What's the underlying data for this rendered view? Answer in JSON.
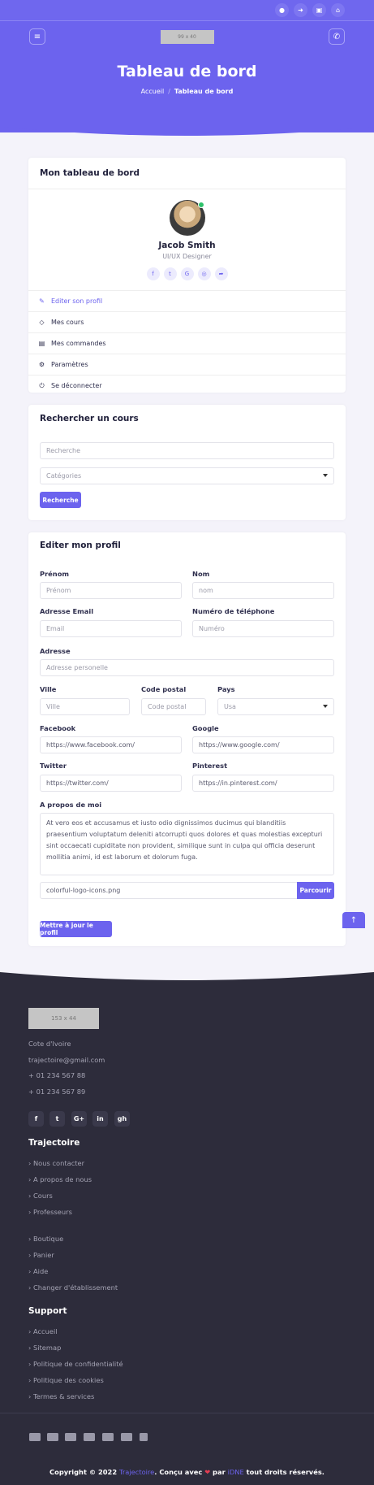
{
  "topbar": {
    "icons": [
      "user-icon",
      "sign-in-icon",
      "cart-icon",
      "home-icon"
    ]
  },
  "header": {
    "logo_placeholder": "99 x 40",
    "title": "Tableau de bord",
    "breadcrumb": {
      "home": "Accueil",
      "separator": "/",
      "current": "Tableau de bord"
    }
  },
  "dashboard": {
    "title": "Mon tableau de bord",
    "profile": {
      "name": "Jacob Smith",
      "role": "UI/UX Designer"
    },
    "menu": [
      {
        "label": "Editer son profil",
        "icon": "edit-icon"
      },
      {
        "label": "Mes cours",
        "icon": "layers-icon"
      },
      {
        "label": "Mes commandes",
        "icon": "calendar-icon"
      },
      {
        "label": "Paramètres",
        "icon": "settings-icon"
      },
      {
        "label": "Se déconnecter",
        "icon": "power-icon"
      }
    ]
  },
  "search": {
    "title": "Rechercher un cours",
    "placeholder": "Recherche",
    "category_value": "Catégories",
    "button": "Recherche"
  },
  "edit": {
    "title": "Editer mon profil",
    "prenom_label": "Prénom",
    "prenom_placeholder": "Prénom",
    "nom_label": "Nom",
    "nom_placeholder": "nom",
    "email_label": "Adresse Email",
    "email_placeholder": "Email",
    "phone_label": "Numéro de téléphone",
    "phone_placeholder": "Numéro",
    "address_label": "Adresse",
    "address_placeholder": "Adresse personelle",
    "city_label": "Ville",
    "city_placeholder": "Ville",
    "postal_label": "Code postal",
    "postal_placeholder": "Code postal",
    "country_label": "Pays",
    "country_value": "Usa",
    "facebook_label": "Facebook",
    "facebook_value": "https://www.facebook.com/",
    "google_label": "Google",
    "google_value": "https://www.google.com/",
    "twitter_label": "Twitter",
    "twitter_value": "https://twitter.com/",
    "pinterest_label": "Pinterest",
    "pinterest_value": "https://in.pinterest.com/",
    "about_label": "A propos de moi",
    "about_value": "At vero eos et accusamus et iusto odio dignissimos ducimus qui blanditiis praesentium voluptatum deleniti atcorrupti quos dolores et quas molestias excepturi sint occaecati cupiditate non provident, similique sunt in culpa qui officia deserunt mollitia animi, id est laborum et dolorum fuga.",
    "file_value": "colorful-logo-icons.png",
    "file_button": "Parcourir",
    "submit": "Mettre à jour le profil"
  },
  "footer": {
    "logo_placeholder": "153 x 44",
    "location": "Cote d'Ivoire",
    "email": "trajectoire@gmail.com",
    "phone1": "+ 01 234 567 88",
    "phone2": "+ 01 234 567 89",
    "social_labels": [
      "f",
      "t",
      "G+",
      "in",
      "gh"
    ],
    "trajectoire_title": "Trajectoire",
    "links1": [
      "Nous contacter",
      "A propos de nous",
      "Cours",
      "Professeurs"
    ],
    "links2": [
      "Boutique",
      "Panier",
      "Aide",
      "Changer d'établissement"
    ],
    "support_title": "Support",
    "support_links": [
      "Accueil",
      "Sitemap",
      "Politique de confidentialité",
      "Politique des cookies",
      "Termes & services"
    ],
    "copyright_prefix": "Copyright © 2022",
    "brand": "Trajectoire",
    "made_with": ". Conçu avec",
    "by": "par",
    "author": "iDNE",
    "rights": "tout droits réservés."
  },
  "colors": {
    "primary": "#6c63ee",
    "footer_bg": "#2d2c3b",
    "page_bg": "#f4f3fa",
    "online": "#2ec16a"
  }
}
